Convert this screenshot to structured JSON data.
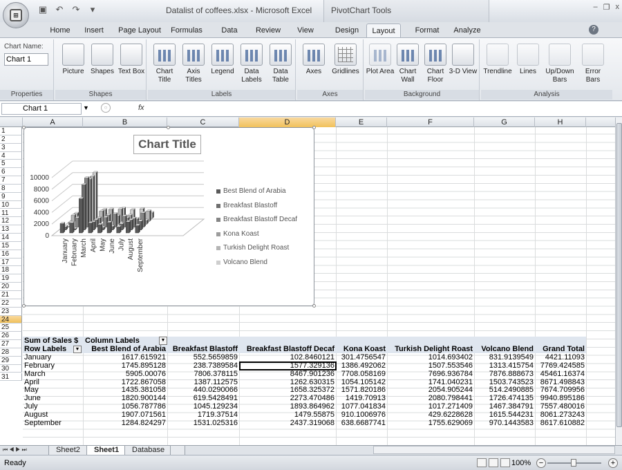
{
  "window": {
    "title": "Datalist of coffees.xlsx - Microsoft Excel",
    "context_header": "PivotChart Tools"
  },
  "tabs": [
    {
      "label": "Home"
    },
    {
      "label": "Insert"
    },
    {
      "label": "Page Layout"
    },
    {
      "label": "Formulas"
    },
    {
      "label": "Data"
    },
    {
      "label": "Review"
    },
    {
      "label": "View"
    },
    {
      "label": "Design"
    },
    {
      "label": "Layout"
    },
    {
      "label": "Format"
    },
    {
      "label": "Analyze"
    }
  ],
  "ribbon": {
    "chart_name_label": "Chart Name:",
    "chart_name_value": "Chart 1",
    "groups": {
      "properties": "Properties",
      "shapes": "Shapes",
      "labels": "Labels",
      "axes": "Axes",
      "background": "Background",
      "analysis": "Analysis"
    },
    "buttons": {
      "picture": "Picture",
      "shapes": "Shapes",
      "text_box": "Text Box",
      "chart_title": "Chart Title",
      "axis_titles": "Axis Titles",
      "legend": "Legend",
      "data_labels": "Data Labels",
      "data_table": "Data Table",
      "axes": "Axes",
      "gridlines": "Gridlines",
      "plot_area": "Plot Area",
      "chart_wall": "Chart Wall",
      "chart_floor": "Chart Floor",
      "rotation": "3-D View",
      "trendline": "Trendline",
      "lines": "Lines",
      "updown_bars": "Up/Down Bars",
      "error_bars": "Error Bars"
    }
  },
  "formula_bar": {
    "name_box": "Chart 1",
    "fx": "fx",
    "value": ""
  },
  "columns": [
    "A",
    "B",
    "C",
    "D",
    "E",
    "F",
    "G",
    "H"
  ],
  "rows": [
    "1",
    "2",
    "3",
    "4",
    "5",
    "6",
    "7",
    "8",
    "9",
    "10",
    "11",
    "12",
    "13",
    "14",
    "15",
    "16",
    "17",
    "18",
    "19",
    "20",
    "21",
    "22",
    "23",
    "24",
    "25",
    "26",
    "27",
    "28",
    "29",
    "30",
    "31"
  ],
  "chart": {
    "title": "Chart Title",
    "y_ticks": [
      "10000",
      "8000",
      "6000",
      "4000",
      "2000",
      "0"
    ],
    "x_labels": [
      "January",
      "February",
      "March",
      "April",
      "May",
      "June",
      "July",
      "August",
      "September"
    ],
    "legend": [
      {
        "name": "Best Blend of Arabia",
        "color": "#595959"
      },
      {
        "name": "Breakfast Blastoff",
        "color": "#6e6e6e"
      },
      {
        "name": "Breakfast Blastoff Decaf",
        "color": "#858585"
      },
      {
        "name": "Kona Koast",
        "color": "#9c9c9c"
      },
      {
        "name": "Turkish Delight Roast",
        "color": "#b5b5b5"
      },
      {
        "name": "Volcano Blend",
        "color": "#cecece"
      }
    ]
  },
  "chart_data": {
    "type": "bar",
    "title": "Chart Title",
    "categories": [
      "January",
      "February",
      "March",
      "April",
      "May",
      "June",
      "July",
      "August",
      "September"
    ],
    "ylim": [
      0,
      10000
    ],
    "series": [
      {
        "name": "Best Blend of Arabia",
        "values": [
          1617.615921,
          1745.895128,
          5905.00076,
          1722.867058,
          1435.381058,
          1820.900144,
          1056.787786,
          1907.071561,
          1284.824297
        ]
      },
      {
        "name": "Breakfast Blastoff",
        "values": [
          552.5659859,
          238.7389584,
          7806.378115,
          1387.112575,
          440.0290066,
          619.5428491,
          1045.129234,
          1719.37514,
          1531.025316
        ]
      },
      {
        "name": "Breakfast Blastoff Decaf",
        "values": [
          102.8460121,
          1577.329136,
          8467.901236,
          1262.630315,
          1658.325372,
          2273.470486,
          1893.864962,
          1479.55875,
          2437.319068
        ]
      },
      {
        "name": "Kona Koast",
        "values": [
          301.4756547,
          1386.492062,
          7708.058169,
          1054.105142,
          1571.820186,
          1419.70913,
          1077.041834,
          910.1006976,
          638.6687741
        ]
      },
      {
        "name": "Turkish Delight Roast",
        "values": [
          1014.693402,
          1507.553546,
          7696.936784,
          1741.040231,
          2054.905244,
          2080.798441,
          1017.271409,
          429.6228628,
          1755.629069
        ]
      },
      {
        "name": "Volcano Blend",
        "values": [
          831.9139549,
          1313.415754,
          7876.888673,
          1503.743523,
          514.2490885,
          1726.474135,
          1467.384791,
          1615.544231,
          970.1443583
        ]
      }
    ]
  },
  "pivot": {
    "r21": {
      "a": "Sum of Sales $",
      "b": "Column Labels"
    },
    "header": [
      "Row Labels",
      "Best Blend of Arabia",
      "Breakfast Blastoff",
      "Breakfast Blastoff Decaf",
      "Kona Koast",
      "Turkish Delight Roast",
      "Volcano Blend",
      "Grand Total"
    ],
    "rows": [
      [
        "January",
        "1617.615921",
        "552.5659859",
        "102.8460121",
        "301.4756547",
        "1014.693402",
        "831.9139549",
        "4421.11093"
      ],
      [
        "February",
        "1745.895128",
        "238.7389584",
        "1577.329136",
        "1386.492062",
        "1507.553546",
        "1313.415754",
        "7769.424585"
      ],
      [
        "March",
        "5905.00076",
        "7806.378115",
        "8467.901236",
        "7708.058169",
        "7696.936784",
        "7876.888673",
        "45461.16374"
      ],
      [
        "April",
        "1722.867058",
        "1387.112575",
        "1262.630315",
        "1054.105142",
        "1741.040231",
        "1503.743523",
        "8671.498843"
      ],
      [
        "May",
        "1435.381058",
        "440.0290066",
        "1658.325372",
        "1571.820186",
        "2054.905244",
        "514.2490885",
        "7674.709956"
      ],
      [
        "June",
        "1820.900144",
        "619.5428491",
        "2273.470486",
        "1419.70913",
        "2080.798441",
        "1726.474135",
        "9940.895186"
      ],
      [
        "July",
        "1056.787786",
        "1045.129234",
        "1893.864962",
        "1077.041834",
        "1017.271409",
        "1467.384791",
        "7557.480016"
      ],
      [
        "August",
        "1907.071561",
        "1719.37514",
        "1479.55875",
        "910.1006976",
        "429.6228628",
        "1615.544231",
        "8061.273243"
      ],
      [
        "September",
        "1284.824297",
        "1531.025316",
        "2437.319068",
        "638.6687741",
        "1755.629069",
        "970.1443583",
        "8617.610882"
      ]
    ]
  },
  "sheet_tabs": [
    "Sheet2",
    "Sheet1",
    "Database"
  ],
  "status": {
    "ready": "Ready",
    "zoom": "100%"
  }
}
